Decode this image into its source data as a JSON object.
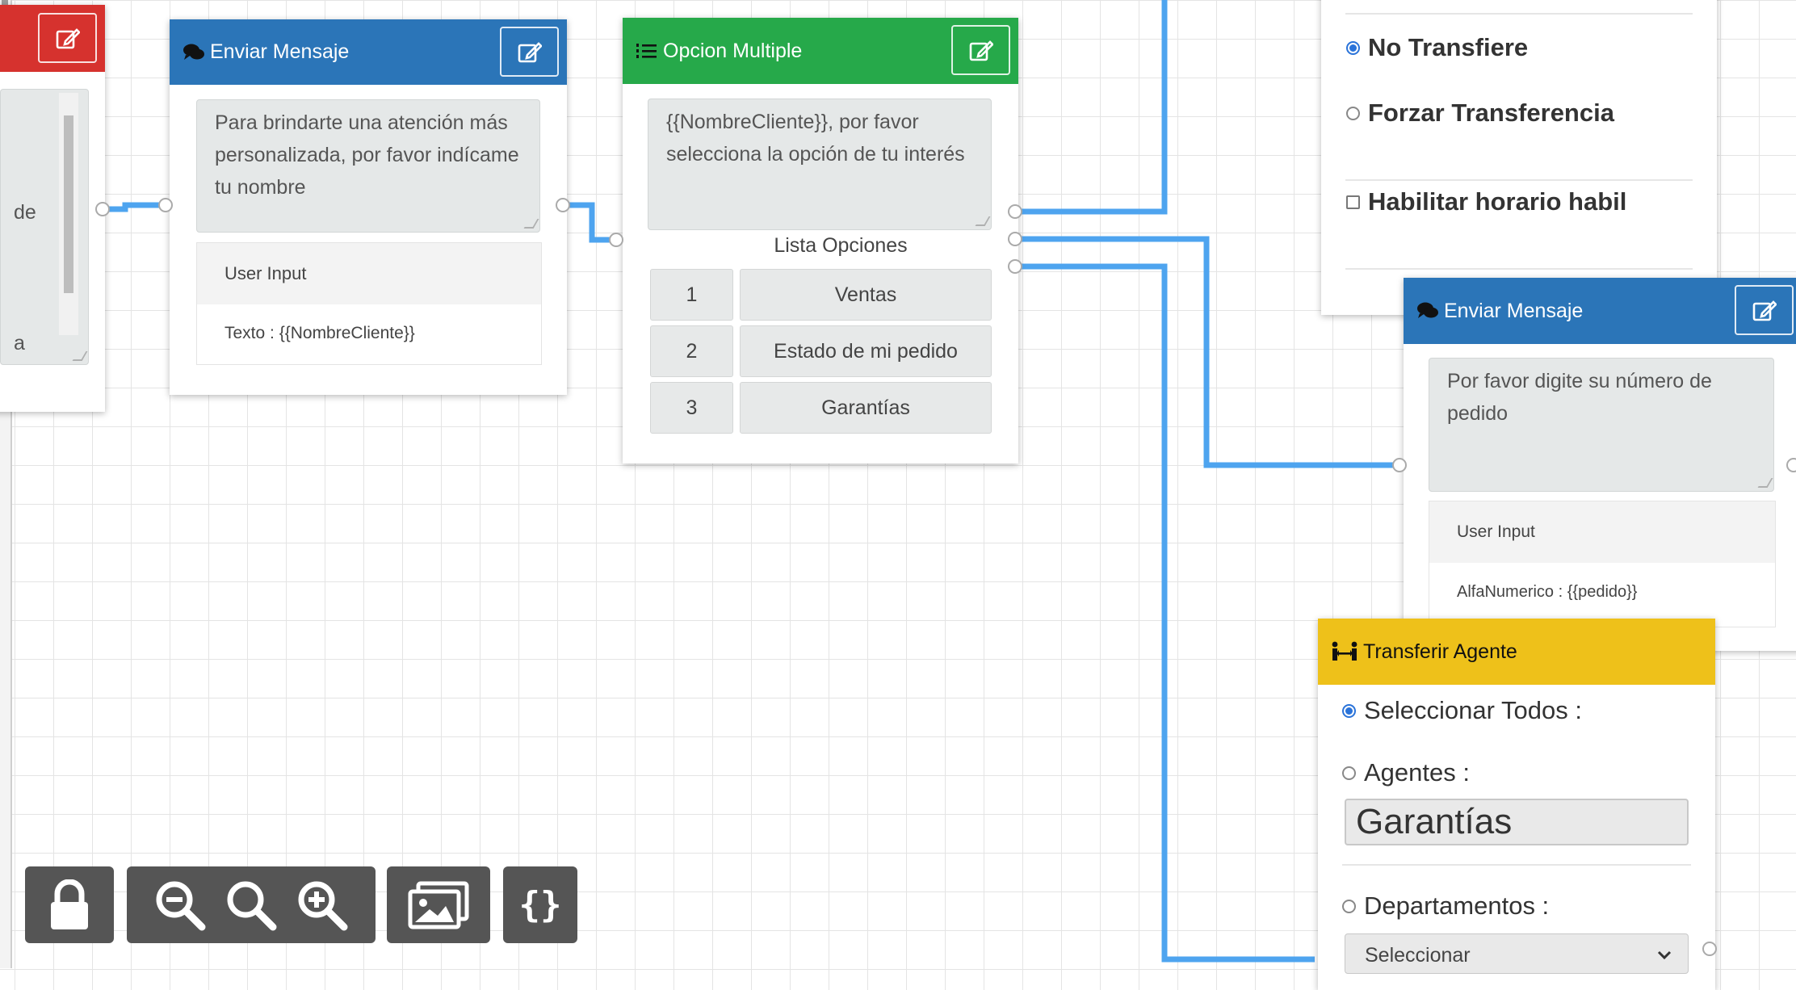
{
  "colors": {
    "send_header": "#2b75b8",
    "option_header": "#26a94a",
    "transfer_header": "#eec11a",
    "red_header": "#d6322e",
    "wire": "#4ea4ef",
    "toolbar": "#555555"
  },
  "left_node": {
    "text_line1": "de",
    "text_line2": "a"
  },
  "send_message_1": {
    "title": "Enviar Mensaje",
    "icon": "comments-icon",
    "message": "Para brindarte una atención más personalizada, por favor indícame tu nombre",
    "user_input_title": "User Input",
    "user_input_value": "Texto : {{NombreCliente}}"
  },
  "multiple_option": {
    "title": "Opcion Multiple",
    "icon": "list-ol-icon",
    "message": "{{NombreCliente}}, por favor selecciona la opción de tu interés",
    "list_label": "Lista Opciones",
    "options": [
      {
        "num": "1",
        "label": "Ventas"
      },
      {
        "num": "2",
        "label": "Estado de mi pedido"
      },
      {
        "num": "3",
        "label": "Garantías"
      }
    ]
  },
  "settings_panel": {
    "no_transfer": "No Transfiere",
    "force_transfer": "Forzar Transferencia",
    "business_hours": "Habilitar horario habil"
  },
  "send_message_2": {
    "title": "Enviar Mensaje",
    "icon": "comments-icon",
    "message": "Por favor digite su número de pedido",
    "user_input_title": "User Input",
    "user_input_value": "AlfaNumerico : {{pedido}}"
  },
  "transfer_agent": {
    "title": "Transferir Agente",
    "icon": "people-arrows-icon",
    "select_all": "Seleccionar Todos :",
    "agents": "Agentes :",
    "agents_value": "Garantías",
    "departments": "Departamentos :",
    "departments_select": "Seleccionar"
  },
  "toolbar": {
    "lock": "lock-icon",
    "zoom_out": "zoom-out-icon",
    "zoom_reset": "zoom-reset-icon",
    "zoom_in": "zoom-in-icon",
    "export_image": "image-icon",
    "export_json": "{}"
  }
}
